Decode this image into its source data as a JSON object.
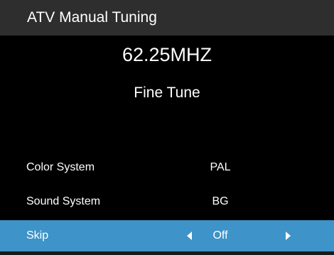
{
  "header": {
    "title": "ATV Manual Tuning"
  },
  "tuning": {
    "frequency": "62.25MHZ",
    "fine_tune_label": "Fine Tune"
  },
  "menu": {
    "items": [
      {
        "label": "Color System",
        "value": "PAL",
        "selected": false
      },
      {
        "label": "Sound System",
        "value": "BG",
        "selected": false
      },
      {
        "label": "Skip",
        "value": "Off",
        "selected": true,
        "has_arrows": true
      }
    ]
  },
  "icons": {
    "left": "triangle-left-icon",
    "right": "triangle-right-icon"
  },
  "colors": {
    "background": "#000000",
    "title_bar": "#2e2e2e",
    "selection_highlight": "#3e93c8",
    "text": "#ffffff"
  }
}
